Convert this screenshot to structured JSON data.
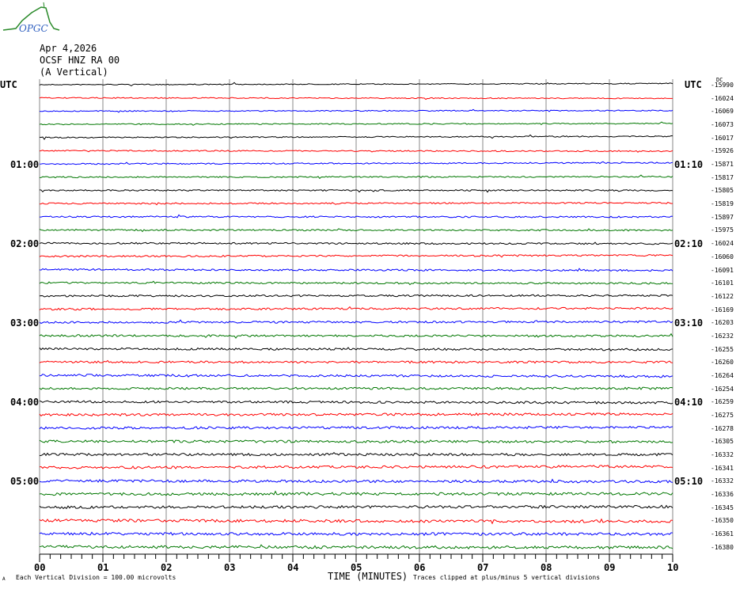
{
  "logo": {
    "text": "OPGC"
  },
  "header": {
    "date": "Apr 4,2026",
    "station": "OCSF HNZ RA 00",
    "component": "(A Vertical)"
  },
  "left_tz": "UTC",
  "right_tz": "UTC",
  "dc_label": "DC",
  "chart_data": {
    "type": "line",
    "title": "Apr 4,2026 OCSF HNZ RA 00 (A Vertical)",
    "xlabel": "TIME (MINUTES)",
    "xlim": [
      0,
      10
    ],
    "x_ticks": [
      "00",
      "01",
      "02",
      "03",
      "04",
      "05",
      "06",
      "07",
      "08",
      "09",
      "10"
    ],
    "trace_count": 36,
    "trace_minutes": 10,
    "colors": [
      "#000000",
      "#ff0000",
      "#0000ff",
      "#007700"
    ],
    "left_hour_labels": [
      "01:00",
      "02:00",
      "03:00",
      "04:00",
      "05:00"
    ],
    "right_hour_labels": [
      "01:10",
      "02:10",
      "03:10",
      "04:10",
      "05:10"
    ],
    "dc_offsets": [
      -15990,
      -16024,
      -16069,
      -16073,
      -16017,
      -15926,
      -15871,
      -15817,
      -15805,
      -15819,
      -15897,
      -15975,
      -16024,
      -16060,
      -16091,
      -16101,
      -16122,
      -16169,
      -16203,
      -16232,
      -16255,
      -16260,
      -16264,
      -16254,
      -16259,
      -16275,
      -16278,
      -16305,
      -16332,
      -16341,
      -16332,
      -16336,
      -16345,
      -16350,
      -16361,
      -16380
    ],
    "scale_note": "Each Vertical Division =  100.00 microvolts",
    "clip_note": "Traces clipped at plus/minus 5 vertical divisions",
    "corner_mark": "A"
  }
}
